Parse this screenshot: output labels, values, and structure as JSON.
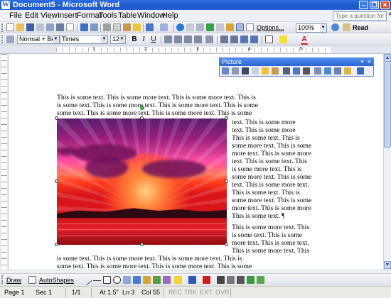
{
  "window": {
    "title": "Document5 - Microsoft Word",
    "app_icon": "W"
  },
  "menu": [
    "File",
    "Edit",
    "View",
    "Insert",
    "Format",
    "Tools",
    "Table",
    "Window",
    "Help"
  ],
  "help_box": {
    "placeholder": "Type a question for help"
  },
  "standard_toolbar": {
    "options_label": "Options...",
    "zoom": "100%",
    "read_label": "Read"
  },
  "formatting_toolbar": {
    "style": "Normal + Befor",
    "font": "Times",
    "size": "12",
    "bold": "B",
    "italic": "I",
    "underline": "U",
    "font_color_letter": "A"
  },
  "ruler_numbers": [
    "1",
    "2",
    "3",
    "4",
    "5"
  ],
  "document": {
    "top_lines": [
      "This is some text. This is some more text. This is some more text. This is",
      "is some text. This is some more text. This is some more text. This is some",
      "some text. This is some more text. This is some more text. This is some"
    ],
    "wrap_lines": [
      "text. This is some more",
      "text. This is some more",
      "This is some text. This is",
      "some more text. This is some",
      "more text. This is some more",
      "text. This is some text. This",
      "is some more text. This is",
      "some more text. This is some",
      "text. This is some more text.",
      "This is some text. This is",
      "some more text. This is some",
      "more text. This is some more",
      "This is some text. ¶"
    ],
    "wrap_lines_2": [
      "This is some more text. This",
      "is some text. This is some",
      "more text. This is some text.",
      "This is some more text. This"
    ],
    "bottom_lines": [
      "is some text. This is some more text. This is some more text. This is",
      "some text. This is some more text. This is some more text. This is some",
      "is some text. This is some more text. This is some more text. This is some"
    ]
  },
  "picture_toolbar": {
    "title": "Picture",
    "close": "×",
    "dropdown": "▾"
  },
  "drawing_toolbar": {
    "draw_label": "Draw",
    "autoshapes_label": "AutoShapes"
  },
  "status": {
    "page": "Page 1",
    "sec": "Sec 1",
    "pages": "1/1",
    "at": "At 1.5\"",
    "ln": "Ln 3",
    "col": "Col 55",
    "modes": [
      "REC",
      "TRK",
      "EXT",
      "OVR"
    ]
  }
}
